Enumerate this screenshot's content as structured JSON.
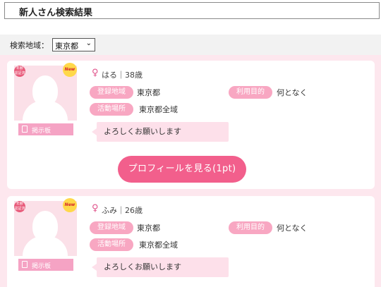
{
  "page": {
    "title": "新人さん検索結果"
  },
  "filter": {
    "label": "検索地域：",
    "region_value": "東京都"
  },
  "labels": {
    "region": "登録地域",
    "area": "活動場所",
    "purpose": "利用目的",
    "board": "掲示板",
    "view_profile": "プロフィールを見る(1pt)",
    "new_badge": "New",
    "verified_badge": "年齢 認証済"
  },
  "results": [
    {
      "name_age": "はる｜38歳",
      "region": "東京都",
      "area": "東京都全域",
      "purpose": "何となく",
      "message": "よろしくお願いします"
    },
    {
      "name_age": "ふみ｜26歳",
      "region": "東京都",
      "area": "東京都全域",
      "purpose": "何となく",
      "message": "よろしくお願いします"
    }
  ],
  "colors": {
    "accent_pink": "#f25f8c",
    "pill_pink": "#f8a7c2",
    "background_pink": "#fde7ee",
    "gender_icon": "#e0528a"
  }
}
